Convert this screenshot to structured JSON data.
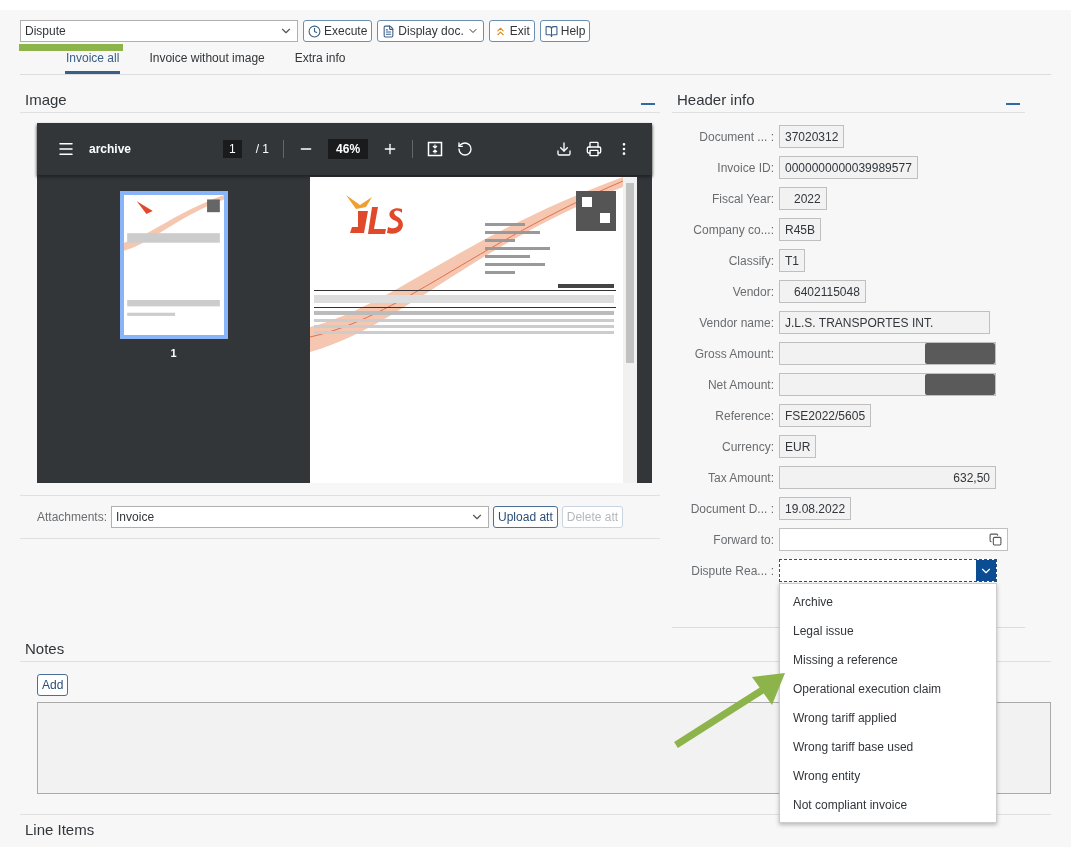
{
  "toolbar": {
    "action_select": {
      "value": "Dispute"
    },
    "buttons": [
      {
        "label": "Execute",
        "kind": "execute"
      },
      {
        "label": "Display doc.",
        "kind": "menu"
      },
      {
        "label": "Exit",
        "kind": "exit"
      },
      {
        "label": "Help",
        "kind": "help"
      }
    ]
  },
  "tabs": [
    {
      "label": "Invoice all",
      "selected": true
    },
    {
      "label": "Invoice without image",
      "selected": false
    },
    {
      "label": "Extra info",
      "selected": false
    }
  ],
  "image_panel": {
    "title": "Image",
    "viewer": {
      "file_name": "archive",
      "page_input": "1",
      "page_total": "/ 1",
      "zoom": "46%",
      "thumbnail_label": "1"
    },
    "attachments": {
      "label": "Attachments:",
      "value": "Invoice"
    },
    "buttons": [
      {
        "label": "Upload att",
        "disabled": false
      },
      {
        "label": "Delete att",
        "disabled": true
      }
    ]
  },
  "header_info": {
    "title": "Header info",
    "fields": [
      {
        "label": "Document ... :",
        "value": "37020312",
        "kind": "text"
      },
      {
        "label": "Invoice ID:",
        "value": "0000000000039989577",
        "kind": "text"
      },
      {
        "label": "Fiscal Year:",
        "value": "2022",
        "kind": "number"
      },
      {
        "label": "Company co...:",
        "value": "R45B",
        "kind": "text"
      },
      {
        "label": "Classify:",
        "value": "T1",
        "kind": "text"
      },
      {
        "label": "Vendor:",
        "value": "6402115048",
        "kind": "number"
      },
      {
        "label": "Vendor name:",
        "value": "J.L.S. TRANSPORTES INT.",
        "kind": "wide"
      },
      {
        "label": "Gross Amount:",
        "kind": "redacted"
      },
      {
        "label": "Net Amount:",
        "kind": "redacted"
      },
      {
        "label": "Reference:",
        "value": "FSE2022/5605",
        "kind": "text"
      },
      {
        "label": "Currency:",
        "value": "EUR",
        "kind": "text"
      },
      {
        "label": "Tax Amount:",
        "value": "632,50",
        "kind": "amount"
      },
      {
        "label": "Document D... :",
        "value": "19.08.2022",
        "kind": "text"
      },
      {
        "label": "Forward to:",
        "kind": "lookup"
      },
      {
        "label": "Dispute Rea... :",
        "kind": "select",
        "expanded": true,
        "options": [
          {
            "label": "Archive",
            "selected": false
          },
          {
            "label": "Legal issue",
            "selected": false
          },
          {
            "label": "Missing a reference",
            "selected": false
          },
          {
            "label": "Operational execution claim",
            "selected": false
          },
          {
            "label": "Wrong tariff applied",
            "selected": false
          },
          {
            "label": "Wrong tariff base used",
            "selected": false
          },
          {
            "label": "Wrong entity",
            "selected": false
          },
          {
            "label": "Not compliant invoice",
            "selected": false
          }
        ]
      }
    ]
  },
  "notes": {
    "title": "Notes",
    "add_button": "Add"
  },
  "line_items": {
    "title": "Line Items"
  }
}
